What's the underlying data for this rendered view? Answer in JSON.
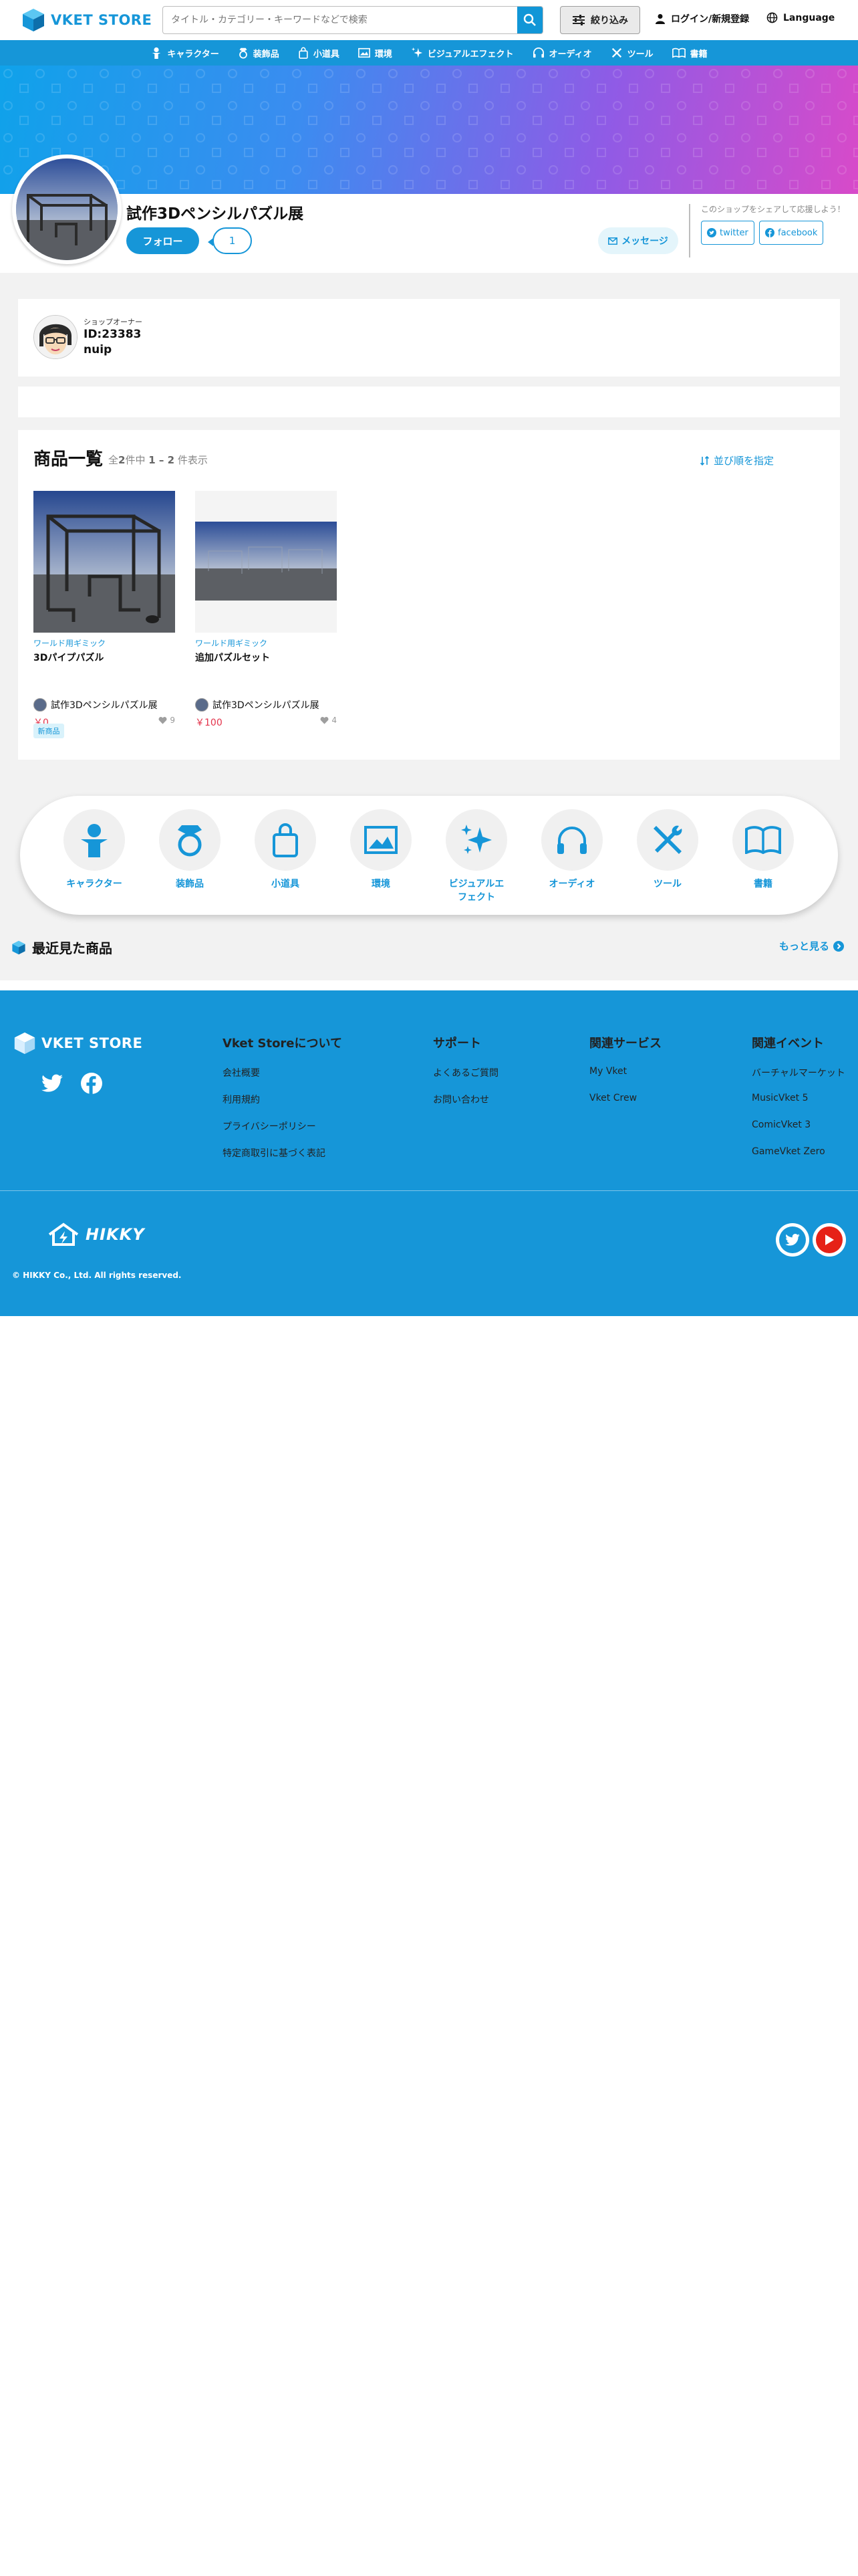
{
  "header": {
    "logo_text": "VKET STORE",
    "search_placeholder": "タイトル・カテゴリー・キーワードなどで検索",
    "filter_label": "絞り込み",
    "login_label": "ログイン/新規登録",
    "language_label": "Language"
  },
  "category_nav": [
    {
      "label": "キャラクター",
      "icon": "character-icon"
    },
    {
      "label": "装飾品",
      "icon": "ring-icon"
    },
    {
      "label": "小道具",
      "icon": "bag-icon"
    },
    {
      "label": "環境",
      "icon": "landscape-icon"
    },
    {
      "label": "ビジュアルエフェクト",
      "icon": "sparkle-icon"
    },
    {
      "label": "オーディオ",
      "icon": "headphones-icon"
    },
    {
      "label": "ツール",
      "icon": "tools-icon"
    },
    {
      "label": "書籍",
      "icon": "book-icon"
    }
  ],
  "shop": {
    "name": "試作3Dペンシルパズル展",
    "follow_label": "フォロー",
    "follower_count": "1",
    "message_label": "メッセージ",
    "share_label": "このショップをシェアして応援しよう！",
    "share_twitter": "twitter",
    "share_facebook": "facebook"
  },
  "owner": {
    "label": "ショップオーナー",
    "id": "ID:23383",
    "name": "nuip"
  },
  "products_section": {
    "title": "商品一覧",
    "count_prefix": "全",
    "count_total": "2",
    "count_mid": "件中",
    "count_range": "1 – 2",
    "count_suffix": "件表示",
    "sort_label": "並び順を指定",
    "items": [
      {
        "category": "ワールド用ギミック",
        "name": "3Dパイプパズル",
        "shop": "試作3Dペンシルパズル展",
        "price": "￥0",
        "likes": "9",
        "tag": "新商品"
      },
      {
        "category": "ワールド用ギミック",
        "name": "追加パズルセット",
        "shop": "試作3Dペンシルパズル展",
        "price": "￥100",
        "likes": "4"
      }
    ]
  },
  "category_bar": [
    {
      "label": "キャラクター",
      "icon": "character-icon"
    },
    {
      "label": "装飾品",
      "icon": "ring-icon"
    },
    {
      "label": "小道具",
      "icon": "bag-icon"
    },
    {
      "label": "環境",
      "icon": "landscape-icon"
    },
    {
      "label_line1": "ビジュアルエ",
      "label_line2": "フェクト",
      "icon": "sparkle-icon"
    },
    {
      "label": "オーディオ",
      "icon": "headphones-icon"
    },
    {
      "label": "ツール",
      "icon": "tools-icon"
    },
    {
      "label": "書籍",
      "icon": "book-icon"
    }
  ],
  "recent": {
    "title": "最近見た商品",
    "more_label": "もっと見る"
  },
  "footer": {
    "logo_text": "VKET STORE",
    "about": {
      "title": "Vket Storeについて",
      "links": [
        "会社概要",
        "利用規約",
        "プライバシーポリシー",
        "特定商取引に基づく表記"
      ]
    },
    "support": {
      "title": "サポート",
      "links": [
        "よくあるご質問",
        "お問い合わせ"
      ]
    },
    "services": {
      "title": "関連サービス",
      "links": [
        "My Vket",
        "Vket Crew"
      ]
    },
    "events": {
      "title": "関連イベント",
      "links": [
        "バーチャルマーケット",
        "MusicVket 5",
        "ComicVket 3",
        "GameVket Zero"
      ]
    },
    "company_logo": "HIKKY",
    "copyright": "© HIKKY Co., Ltd. All rights reserved."
  },
  "colors": {
    "brand": "#1696d8",
    "price": "#e3334b",
    "youtube": "#e62117"
  }
}
